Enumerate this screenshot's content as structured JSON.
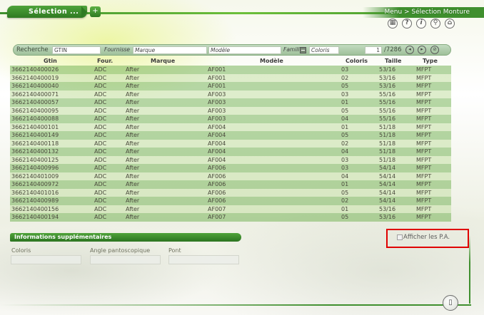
{
  "header": {
    "tab_label": "Sélection ...",
    "add_tab_label": "+",
    "breadcrumb": "Menu > Sélection Monture"
  },
  "toolbar_icons": [
    "calculator-icon",
    "help-icon",
    "info-icon",
    "search-zoom-icon",
    "home-icon"
  ],
  "search": {
    "label": "Recherche",
    "gtin_placeholder": "GTIN",
    "fournisseur_label": "Fournisse",
    "marque_placeholder": "Marque",
    "modele_placeholder": "Modèle",
    "famille_label": "Famill",
    "coloris_placeholder": "Coloris",
    "page_value": "1",
    "page_total": "/7286"
  },
  "table": {
    "headers": [
      "Gtin",
      "Four.",
      "Marque",
      "Modèle",
      "Coloris",
      "Taille",
      "Type"
    ],
    "rows": [
      [
        "3662140400026",
        "ADC",
        "After",
        "AF001",
        "03",
        "53/16",
        "MFPT"
      ],
      [
        "3662140400019",
        "ADC",
        "After",
        "AF001",
        "02",
        "53/16",
        "MFPT"
      ],
      [
        "3662140400040",
        "ADC",
        "After",
        "AF001",
        "05",
        "53/16",
        "MFPT"
      ],
      [
        "3662140400071",
        "ADC",
        "After",
        "AF003",
        "03",
        "55/16",
        "MFPT"
      ],
      [
        "3662140400057",
        "ADC",
        "After",
        "AF003",
        "01",
        "55/16",
        "MFPT"
      ],
      [
        "3662140400095",
        "ADC",
        "After",
        "AF003",
        "05",
        "55/16",
        "MFPT"
      ],
      [
        "3662140400088",
        "ADC",
        "After",
        "AF003",
        "04",
        "55/16",
        "MFPT"
      ],
      [
        "3662140400101",
        "ADC",
        "After",
        "AF004",
        "01",
        "51/18",
        "MFPT"
      ],
      [
        "3662140400149",
        "ADC",
        "After",
        "AF004",
        "05",
        "51/18",
        "MFPT"
      ],
      [
        "3662140400118",
        "ADC",
        "After",
        "AF004",
        "02",
        "51/18",
        "MFPT"
      ],
      [
        "3662140400132",
        "ADC",
        "After",
        "AF004",
        "04",
        "51/18",
        "MFPT"
      ],
      [
        "3662140400125",
        "ADC",
        "After",
        "AF004",
        "03",
        "51/18",
        "MFPT"
      ],
      [
        "3662140400996",
        "ADC",
        "After",
        "AF006",
        "03",
        "54/14",
        "MFPT"
      ],
      [
        "3662140401009",
        "ADC",
        "After",
        "AF006",
        "04",
        "54/14",
        "MFPT"
      ],
      [
        "3662140400972",
        "ADC",
        "After",
        "AF006",
        "01",
        "54/14",
        "MFPT"
      ],
      [
        "3662140401016",
        "ADC",
        "After",
        "AF006",
        "05",
        "54/14",
        "MFPT"
      ],
      [
        "3662140400989",
        "ADC",
        "After",
        "AF006",
        "02",
        "54/14",
        "MFPT"
      ],
      [
        "3662140400156",
        "ADC",
        "After",
        "AF007",
        "01",
        "53/16",
        "MFPT"
      ],
      [
        "3662140400194",
        "ADC",
        "After",
        "AF007",
        "05",
        "53/16",
        "MFPT"
      ]
    ]
  },
  "info": {
    "title": "Informations supplémentaires",
    "coloris_label": "Coloris",
    "angle_label": "Angle pantoscopique",
    "pont_label": "Pont"
  },
  "pa": {
    "label": "Afficher les P.A.",
    "checked": false
  },
  "colors": {
    "accent": "#3f8f2e",
    "highlight_box": "#e00000"
  }
}
